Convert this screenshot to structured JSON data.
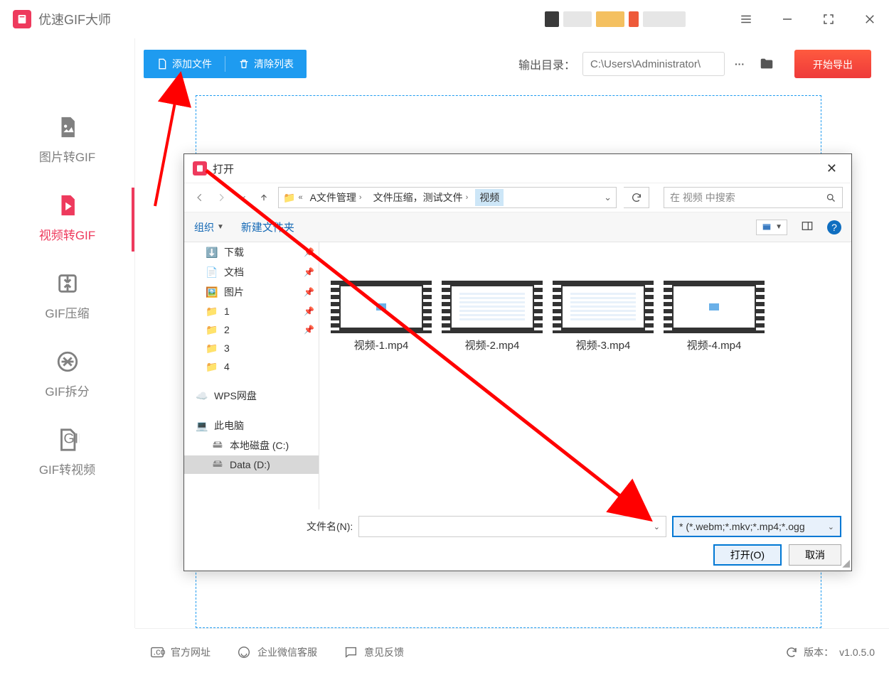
{
  "app": {
    "title": "优速GIF大师"
  },
  "window_controls": {
    "menu": "menu",
    "min": "minimize",
    "full": "fullscreen",
    "close": "close"
  },
  "sidebar": {
    "items": [
      {
        "label": "图片转GIF",
        "icon": "image-file-icon",
        "key": "img2gif"
      },
      {
        "label": "视频转GIF",
        "icon": "video-file-icon",
        "key": "vid2gif",
        "active": true
      },
      {
        "label": "GIF压缩",
        "icon": "compress-icon",
        "key": "gifcompress"
      },
      {
        "label": "GIF拆分",
        "icon": "split-icon",
        "key": "gifsplit"
      },
      {
        "label": "GIF转视频",
        "icon": "gif-file-icon",
        "key": "gif2vid"
      }
    ]
  },
  "toolbar": {
    "add_label": "添加文件",
    "clear_label": "清除列表",
    "output_label": "输出目录：",
    "output_path": "C:\\Users\\Administrator\\",
    "browse_dots": "···",
    "export_label": "开始导出"
  },
  "footer": {
    "site_label": "官方网址",
    "wechat_label": "企业微信客服",
    "feedback_label": "意见反馈",
    "version_label": "版本：",
    "version": "v1.0.5.0"
  },
  "dialog": {
    "title": "打开",
    "breadcrumb": {
      "hint": "«",
      "segments": [
        "A文件管理",
        "文件压缩，测试文件",
        "视频"
      ]
    },
    "search_placeholder": "在 视频 中搜索",
    "tools": {
      "organize": "组织",
      "newfolder": "新建文件夹"
    },
    "tree": [
      {
        "label": "下载",
        "icon": "dl",
        "pin": true
      },
      {
        "label": "文档",
        "icon": "doc",
        "pin": true
      },
      {
        "label": "图片",
        "icon": "pic",
        "pin": true
      },
      {
        "label": "1",
        "icon": "folder",
        "pin": true
      },
      {
        "label": "2",
        "icon": "folder",
        "pin": true
      },
      {
        "label": "3",
        "icon": "folder"
      },
      {
        "label": "4",
        "icon": "folder"
      },
      {
        "label": "WPS网盘",
        "icon": "cloud",
        "indent": 0
      },
      {
        "label": "此电脑",
        "icon": "pc",
        "indent": 0
      },
      {
        "label": "本地磁盘 (C:)",
        "icon": "drive",
        "indent": 1
      },
      {
        "label": "Data (D:)",
        "icon": "drive",
        "indent": 1,
        "selected": true
      }
    ],
    "files": [
      {
        "label": "视频-1.mp4",
        "thumb": "blank"
      },
      {
        "label": "视频-2.mp4",
        "thumb": "stripes"
      },
      {
        "label": "视频-3.mp4",
        "thumb": "stripes"
      },
      {
        "label": "视频-4.mp4",
        "thumb": "blank"
      }
    ],
    "filename_label": "文件名(N):",
    "type_filter": "* (*.webm;*.mkv;*.mp4;*.ogg",
    "open_btn": "打开(O)",
    "cancel_btn": "取消"
  }
}
